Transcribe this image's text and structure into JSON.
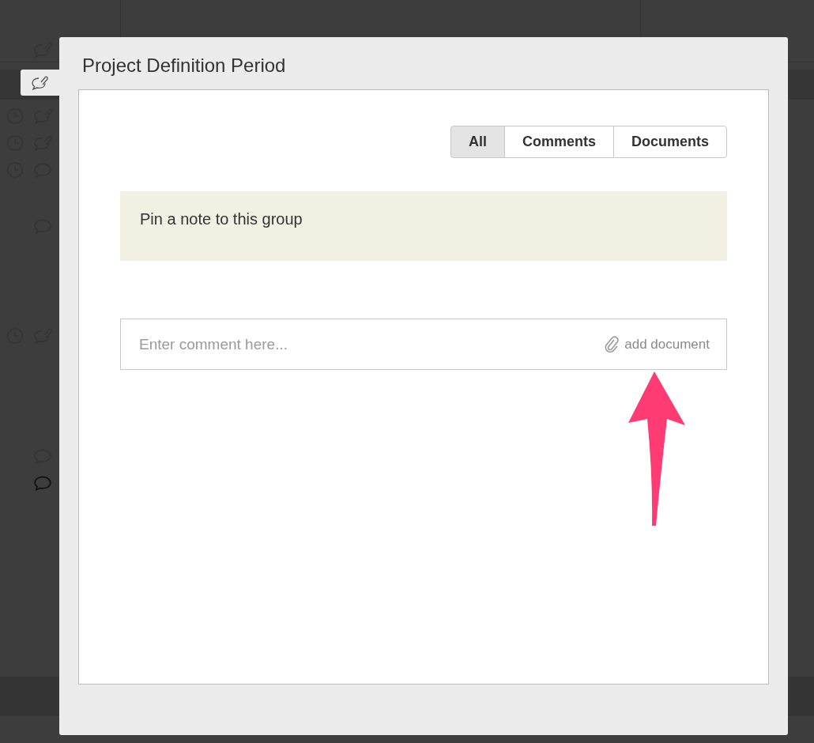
{
  "dialog": {
    "title": "Project Definition Period",
    "filters": [
      {
        "label": "All",
        "selected": true
      },
      {
        "label": "Comments",
        "selected": false
      },
      {
        "label": "Documents",
        "selected": false
      }
    ],
    "pin_note": "Pin a note to this group",
    "comment": {
      "placeholder": "Enter comment here...",
      "attach_label": "add document"
    }
  }
}
